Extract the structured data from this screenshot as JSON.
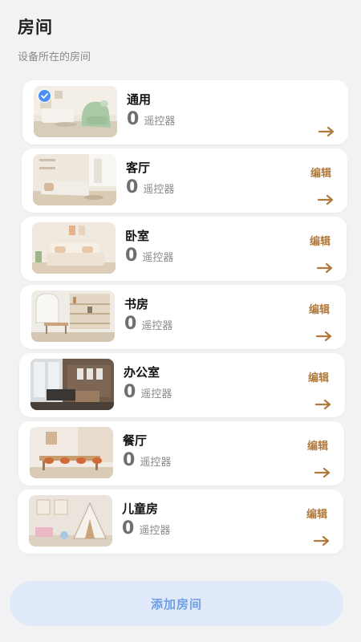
{
  "header": {
    "title": "房间",
    "subtitle": "设备所在的房间"
  },
  "rooms": [
    {
      "name": "通用",
      "count": "0",
      "count_label": "遥控器",
      "edit": "",
      "selected": true,
      "thumb": "room-living-green-chair"
    },
    {
      "name": "客厅",
      "count": "0",
      "count_label": "遥控器",
      "edit": "编辑",
      "selected": false,
      "thumb": "room-living-sofa"
    },
    {
      "name": "卧室",
      "count": "0",
      "count_label": "遥控器",
      "edit": "编辑",
      "selected": false,
      "thumb": "room-bedroom"
    },
    {
      "name": "书房",
      "count": "0",
      "count_label": "遥控器",
      "edit": "编辑",
      "selected": false,
      "thumb": "room-study"
    },
    {
      "name": "办公室",
      "count": "0",
      "count_label": "遥控器",
      "edit": "编辑",
      "selected": false,
      "thumb": "room-office"
    },
    {
      "name": "餐厅",
      "count": "0",
      "count_label": "遥控器",
      "edit": "编辑",
      "selected": false,
      "thumb": "room-dining"
    },
    {
      "name": "儿童房",
      "count": "0",
      "count_label": "遥控器",
      "edit": "编辑",
      "selected": false,
      "thumb": "room-kids"
    }
  ],
  "add_button": "添加房间",
  "colors": {
    "accent": "#b07a3c",
    "primary": "#6f9fe6",
    "check": "#4a8ff5"
  }
}
